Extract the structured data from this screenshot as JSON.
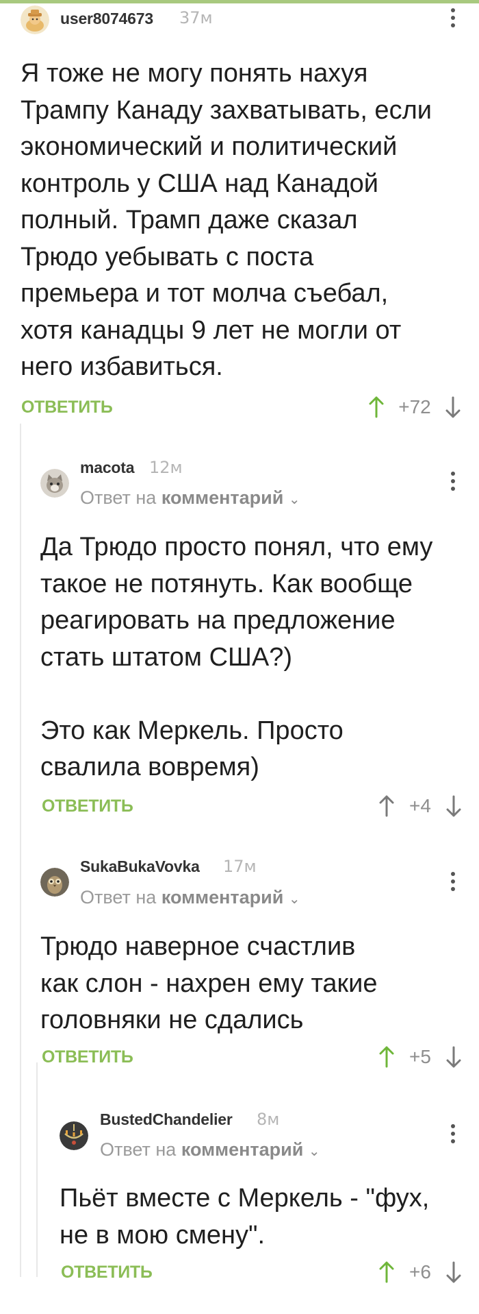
{
  "colors": {
    "accent": "#8bbd56",
    "arrow_up_active": "#6fb63a",
    "arrow_neutral": "#7a7a7a",
    "text": "#1f1f1f",
    "muted": "#9a9a9a"
  },
  "comments": [
    {
      "username": "user8074673",
      "time": "37м",
      "reply_to": null,
      "body": "Я тоже не могу понять нахуя\nТрампу Канаду захватывать, если\nэкономический и политический\nконтроль у США над Канадой\nполный. Трамп даже сказал\nТрюдо уебывать с поста\nпремьера и тот молча съебал,\nхотя канадцы 9 лет не могли от\nнего избавиться.",
      "reply_label": "ОТВЕТИТЬ",
      "score": "+72",
      "upvoted": true,
      "avatar_icon": "person-hat-avatar-icon"
    },
    {
      "username": "macota",
      "time": "12м",
      "reply_to": {
        "prefix": "Ответ на",
        "link": "комментарий"
      },
      "body": "Да Трюдо просто понял, что ему\nтакое не потянуть. Как вообще\nреагировать на предложение\nстать штатом США?)\n\nЭто как Меркель. Просто\nсвалила вовремя)",
      "reply_label": "ОТВЕТИТЬ",
      "score": "+4",
      "upvoted": false,
      "avatar_icon": "cat-avatar-icon"
    },
    {
      "username": "SukaBukaVovka",
      "time": "17м",
      "reply_to": {
        "prefix": "Ответ на",
        "link": "комментарий"
      },
      "body": "Трюдо наверное счастлив\nкак слон - нахрен ему такие\nголовняки не сдались",
      "reply_label": "ОТВЕТИТЬ",
      "score": "+5",
      "upvoted": true,
      "avatar_icon": "owl-avatar-icon"
    },
    {
      "username": "BustedChandelier",
      "time": "8м",
      "reply_to": {
        "prefix": "Ответ на",
        "link": "комментарий"
      },
      "body": "Пьёт вместе с Меркель - \"фух,\nне в мою смену\".",
      "reply_label": "ОТВЕТИТЬ",
      "score": "+6",
      "upvoted": true,
      "avatar_icon": "chandelier-avatar-icon"
    }
  ]
}
